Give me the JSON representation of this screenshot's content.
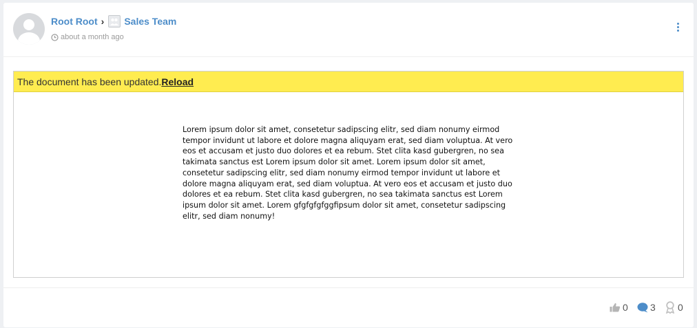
{
  "post": {
    "author": "Root Root",
    "separator": "›",
    "space": "Sales Team",
    "timestamp": "about a month ago"
  },
  "document": {
    "notice": "The document has been updated.",
    "reload_label": "Reload",
    "body": "Lorem ipsum dolor sit amet, consetetur sadipscing elitr, sed diam nonumy eirmod tempor invidunt ut labore et dolore magna aliquyam erat, sed diam voluptua. At vero eos et accusam et justo duo dolores et ea rebum. Stet clita kasd gubergren, no sea takimata sanctus est Lorem ipsum dolor sit amet. Lorem ipsum dolor sit amet, consetetur sadipscing elitr, sed diam nonumy eirmod tempor invidunt ut labore et dolore magna aliquyam erat, sed diam voluptua. At vero eos et accusam et justo duo dolores et ea rebum. Stet clita kasd gubergren, no sea takimata sanctus est Lorem ipsum dolor sit amet. Lorem gfgfgfgfggfipsum dolor sit amet, consetetur sadipscing elitr, sed diam nonumy!"
  },
  "stats": {
    "likes": "0",
    "comments": "3",
    "awards": "0"
  },
  "icons": {
    "avatar": "user-avatar-placeholder",
    "space": "group-icon",
    "time": "clock-icon",
    "menu": "vertical-ellipsis-icon",
    "likes": "thumbs-up-icon",
    "comments": "comment-bubble-icon",
    "awards": "award-icon"
  },
  "colors": {
    "link": "#4d8dc9",
    "notice_background": "#ffec50",
    "muted": "#9a9a9a"
  }
}
